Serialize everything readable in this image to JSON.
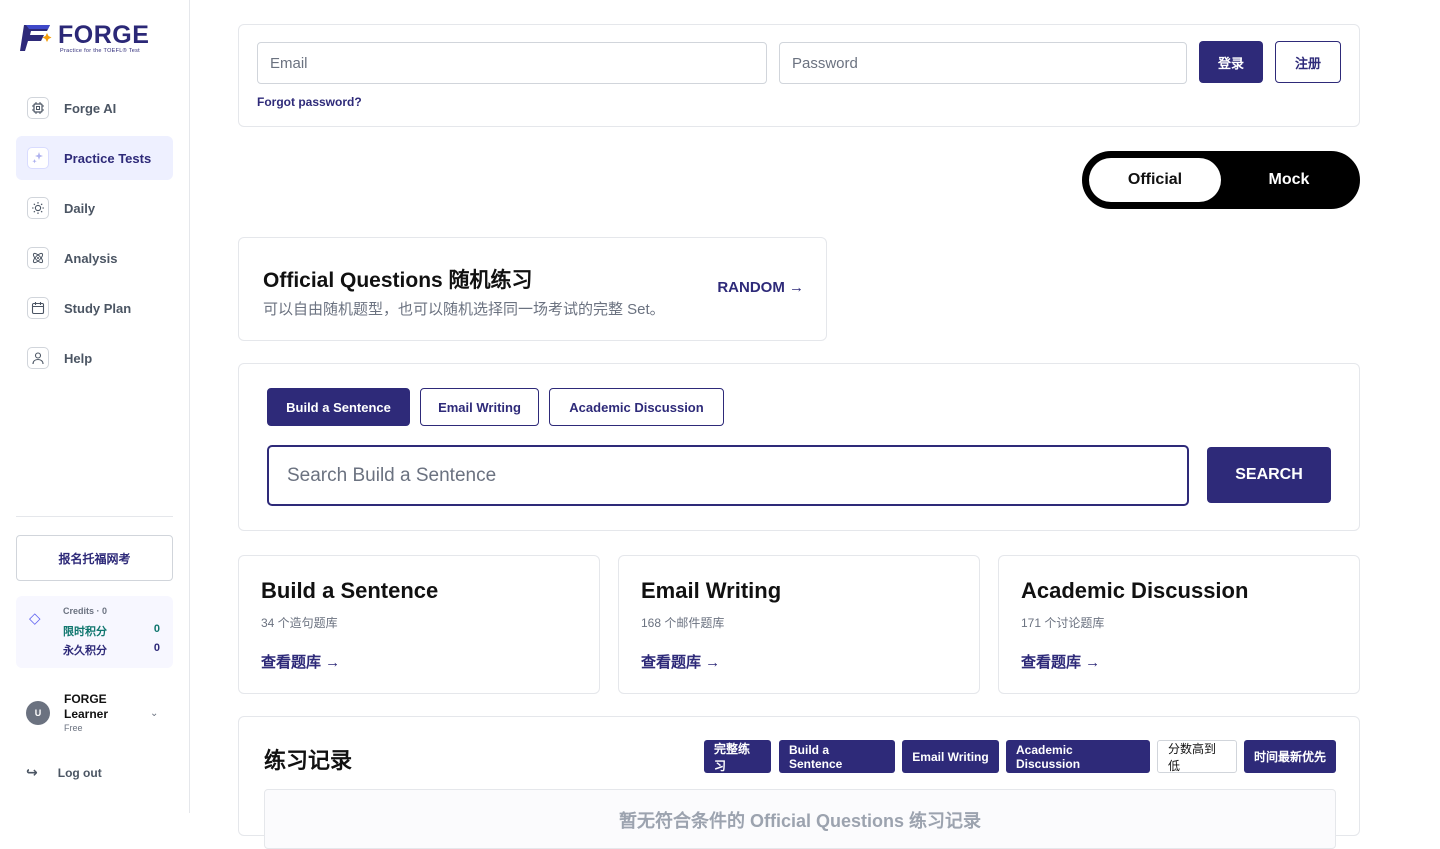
{
  "brand": {
    "name": "FORGE",
    "tagline": "Practice for the TOEFL® Test"
  },
  "sidebar": {
    "items": [
      {
        "label": "Forge AI",
        "icon": "chip-icon"
      },
      {
        "label": "Practice Tests",
        "icon": "sparkle-icon",
        "active": true
      },
      {
        "label": "Daily",
        "icon": "sun-icon"
      },
      {
        "label": "Analysis",
        "icon": "atom-icon"
      },
      {
        "label": "Study Plan",
        "icon": "calendar-icon"
      },
      {
        "label": "Help",
        "icon": "person-icon"
      }
    ],
    "register_exam": "报名托福网考",
    "credits": {
      "title": "Credits · 0",
      "limited_label": "限时积分",
      "limited_value": "0",
      "permanent_label": "永久积分",
      "permanent_value": "0"
    },
    "user": {
      "initial": "U",
      "name": "FORGE Learner",
      "plan": "Free"
    },
    "logout": "Log out"
  },
  "login": {
    "email_placeholder": "Email",
    "password_placeholder": "Password",
    "login_label": "登录",
    "register_label": "注册",
    "forgot": "Forgot password?"
  },
  "mode_toggle": {
    "options": [
      "Official",
      "Mock"
    ],
    "selected": "Official"
  },
  "random": {
    "title": "Official Questions 随机练习",
    "subtitle": "可以自由随机题型，也可以随机选择同一场考试的完整 Set。",
    "link": "RANDOM →"
  },
  "search": {
    "tabs": [
      "Build a Sentence",
      "Email Writing",
      "Academic Discussion"
    ],
    "selected": "Build a Sentence",
    "placeholder": "Search Build a Sentence",
    "button": "SEARCH"
  },
  "banks": [
    {
      "title": "Build a Sentence",
      "count": "34 个造句题库",
      "link": "查看题库 →"
    },
    {
      "title": "Email Writing",
      "count": "168 个邮件题库",
      "link": "查看题库 →"
    },
    {
      "title": "Academic Discussion",
      "count": "171 个讨论题库",
      "link": "查看题库 →"
    }
  ],
  "history": {
    "title": "练习记录",
    "filters": [
      "完整练习",
      "Build a Sentence",
      "Email Writing",
      "Academic Discussion",
      "分数高到低",
      "时间最新优先"
    ],
    "empty": "暂无符合条件的 Official Questions 练习记录"
  },
  "colors": {
    "accent": "#2e2a79",
    "active_bg": "#eef0ff",
    "limited_credit": "#0f766e"
  }
}
